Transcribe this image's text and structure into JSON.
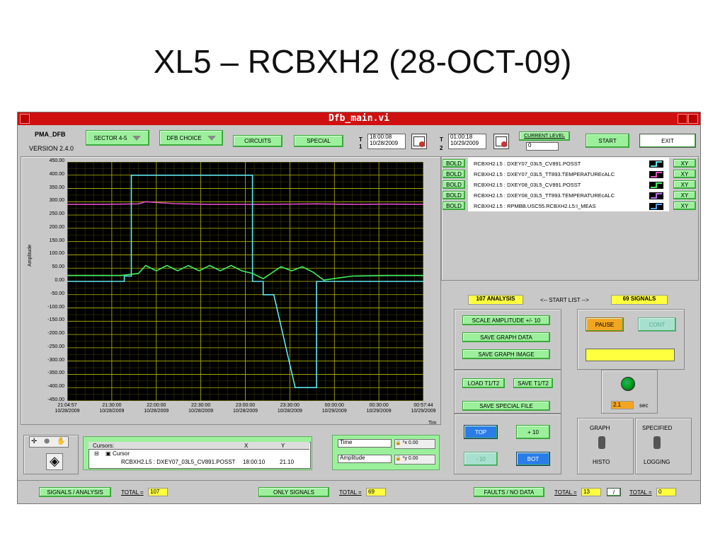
{
  "slide_title": "XL5 – RCBXH2 (28-OCT-09)",
  "window_title": "Dfb_main.vi",
  "header": {
    "app_name": "PMA_DFB",
    "version": "VERSION 2.4.0",
    "sector_label": "SECTOR 4-5",
    "dfb_choice_label": "DFB CHOICE",
    "circuits_label": "CIRCUITS",
    "special_label": "SPECIAL",
    "t1_letter": "T",
    "t1_num": "1",
    "t1_time": "18:00:08",
    "t1_date": "10/28/2009",
    "t2_letter": "T",
    "t2_num": "2",
    "t2_time": "01:00:18",
    "t2_date": "10/29/2009",
    "current_level_label": "CURRENT LEVEL",
    "current_level_value": "0",
    "start_label": "START",
    "exit_label": "EXIT"
  },
  "chart_data": {
    "type": "line",
    "ylabel": "Amplitude",
    "xlabel": "Tim",
    "ylim": [
      -450,
      450
    ],
    "yticks": [
      "450.00",
      "400.00",
      "350.00",
      "300.00",
      "250.00",
      "200.00",
      "150.00",
      "100.00",
      "50.00",
      "0.00",
      "-50.00",
      "-100.00",
      "-150.00",
      "-200.00",
      "-250.00",
      "-300.00",
      "-350.00",
      "-400.00",
      "-450.00"
    ],
    "xticks": [
      {
        "time": "21:04:57",
        "date": "10/28/2009"
      },
      {
        "time": "21:30:00",
        "date": "10/28/2009"
      },
      {
        "time": "22:00:00",
        "date": "10/28/2009"
      },
      {
        "time": "22:30:00",
        "date": "10/28/2009"
      },
      {
        "time": "23:00:00",
        "date": "10/28/2009"
      },
      {
        "time": "23:30:00",
        "date": "10/28/2009"
      },
      {
        "time": "00:00:00",
        "date": "10/29/2009"
      },
      {
        "time": "00:30:00",
        "date": "10/29/2009"
      },
      {
        "time": "00:57:44",
        "date": "10/29/2009"
      }
    ],
    "grid": true,
    "background": "#000000",
    "grid_color": "#b8b800",
    "series": [
      {
        "name": "RCBXH2.L5 : DXEY07_03L5_TT893.TEMPERATUREcALC",
        "color": "#e050c0",
        "x": [
          0,
          0.1,
          0.2,
          0.22,
          0.3,
          0.4,
          0.55,
          0.7,
          0.8,
          0.9,
          1.0
        ],
        "y": [
          290,
          290,
          292,
          300,
          293,
          290,
          290,
          292,
          290,
          291,
          290
        ]
      },
      {
        "name": "RCBXH2.L5 : DXEY07_03L5_CV891.POSST",
        "color": "#60e8f0",
        "x": [
          0,
          0.1,
          0.16,
          0.16,
          0.18,
          0.18,
          0.23,
          0.23,
          0.52,
          0.52,
          0.55,
          0.55,
          0.58,
          0.58,
          0.64,
          0.64,
          0.7,
          0.7,
          0.72,
          0.72,
          1.0
        ],
        "y": [
          0,
          0,
          0,
          20,
          20,
          400,
          400,
          400,
          400,
          0,
          0,
          -50,
          -50,
          -50,
          -400,
          -400,
          -400,
          0,
          0,
          0,
          0
        ]
      },
      {
        "name": "RCBXH2.L5 : DXEY08_03L5_CV891.POSST",
        "color": "#40f060",
        "x": [
          0,
          0.1,
          0.15,
          0.2,
          0.22,
          0.25,
          0.28,
          0.31,
          0.34,
          0.37,
          0.4,
          0.43,
          0.46,
          0.49,
          0.52,
          0.55,
          0.6,
          0.63,
          0.66,
          0.69,
          0.72,
          0.8,
          0.9,
          1.0
        ],
        "y": [
          22,
          22,
          22,
          30,
          60,
          40,
          60,
          40,
          60,
          40,
          60,
          40,
          60,
          40,
          30,
          10,
          55,
          40,
          55,
          35,
          5,
          20,
          22,
          22
        ]
      }
    ]
  },
  "signals": [
    {
      "bold": "BOLD",
      "name": "RCBXH2.L5 : DXEY07_03L5_CV891.POSST",
      "color": "#60e8f0",
      "xy": "XY"
    },
    {
      "bold": "BOLD",
      "name": "RCBXH2.L5 : DXEY07_03L5_TT893.TEMPERATUREcALC",
      "color": "#e050c0",
      "xy": "XY"
    },
    {
      "bold": "BOLD",
      "name": "RCBXH2.L5 : DXEY08_03L5_CV891.POSST",
      "color": "#40f060",
      "xy": "XY"
    },
    {
      "bold": "BOLD",
      "name": "RCBXH2.L5 : DXEY08_03L5_TT893.TEMPERATUREcALC",
      "color": "#c070f0",
      "xy": "XY"
    },
    {
      "bold": "BOLD",
      "name": "RCBXH2.L5 : RPMBB.USC55.RCBXH2.L5:I_MEAS",
      "color": "#40a0f0",
      "xy": "XY"
    }
  ],
  "analysis": {
    "count_label": "107 ANALYSIS",
    "start_list": "<-- START LIST -->",
    "signals_label": "69 SIGNALS",
    "scale_amp": "SCALE AMPLITUDE +/- 10",
    "save_graph_data": "SAVE GRAPH DATA",
    "save_graph_image": "SAVE GRAPH IMAGE",
    "pause": "PAUSE",
    "cont": "CONT",
    "load_t1t2": "LOAD T1/T2",
    "save_t1t2": "SAVE T1/T2",
    "save_special": "SAVE SPECIAL FILE",
    "rate_value": "2.1",
    "rate_unit": "sec",
    "top": "TOP",
    "plus10": "+ 10",
    "minus10": "- 10",
    "bot": "BOT",
    "graph": "GRAPH",
    "histo": "HISTO",
    "specified": "SPECIFIED",
    "logging": "LOGGING"
  },
  "cursors": {
    "title": "Cursors:",
    "col_x": "X",
    "col_y": "Y",
    "cursor_name": "Cursor",
    "cursor_signal": "RCBXH2.L5 : DXEY07_03L5_CV891.POSST",
    "x_value": "18:00:10",
    "y_value": "21.10"
  },
  "axes_ctrl": {
    "time_label": "Time",
    "amplitude_label": "Amplitude"
  },
  "status": {
    "signals_analysis": "SIGNALS / ANALYSIS",
    "total1_label": "TOTAL =",
    "total1_value": "107",
    "only_signals": "ONLY SIGNALS",
    "total2_label": "TOTAL =",
    "total2_value": "69",
    "faults": "FAULTS / NO DATA",
    "total3_label": "TOTAL =",
    "total3_value": "13",
    "slash": "/",
    "total4_label": "TOTAL =",
    "total4_value": "0"
  }
}
